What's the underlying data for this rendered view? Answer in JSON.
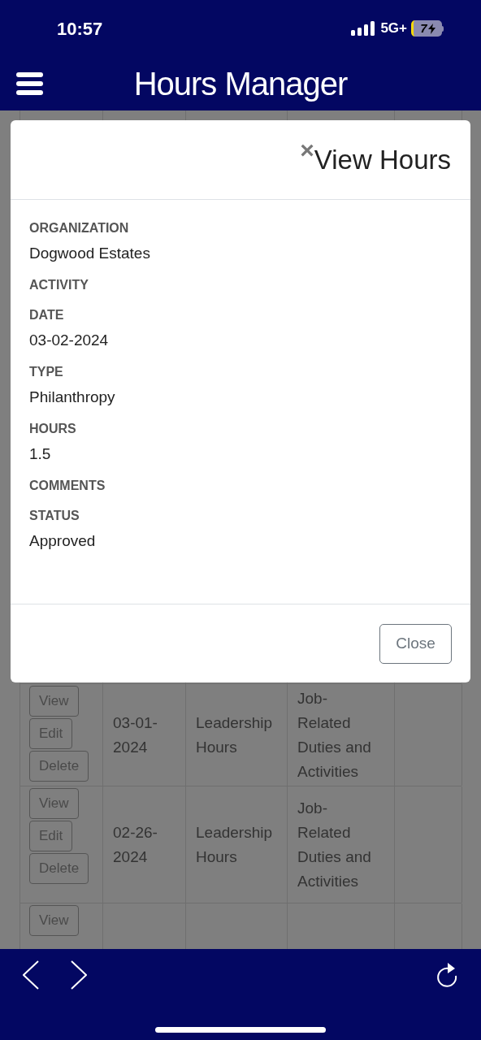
{
  "status_bar": {
    "time": "10:57",
    "network": "5G+",
    "battery": "7"
  },
  "header": {
    "title": "Hours Manager"
  },
  "table": {
    "rows": [
      {
        "actions": [],
        "date": "",
        "activity": "",
        "type": ""
      },
      {
        "actions": [
          "View",
          "Edit",
          "Delete"
        ],
        "date": "03-01-2024",
        "activity": "Leadership Hours",
        "type": "Job-Related Duties and Activities"
      },
      {
        "actions": [
          "View",
          "Edit",
          "Delete"
        ],
        "date": "02-26-2024",
        "activity": "Leadership Hours",
        "type": "Job-Related Duties and Activities"
      },
      {
        "actions": [
          "View"
        ],
        "date": "",
        "activity": "",
        "type": ""
      }
    ]
  },
  "modal": {
    "close": "×",
    "title": "View Hours",
    "fields": [
      {
        "label": "ORGANIZATION",
        "value": "Dogwood Estates"
      },
      {
        "label": "ACTIVITY"
      },
      {
        "label": "DATE",
        "value": "03-02-2024"
      },
      {
        "label": "TYPE",
        "value": "Philanthropy"
      },
      {
        "label": "HOURS",
        "value": "1.5"
      },
      {
        "label": "COMMENTS"
      },
      {
        "label": "STATUS",
        "value": "Approved"
      }
    ],
    "footer_button": "Close"
  }
}
